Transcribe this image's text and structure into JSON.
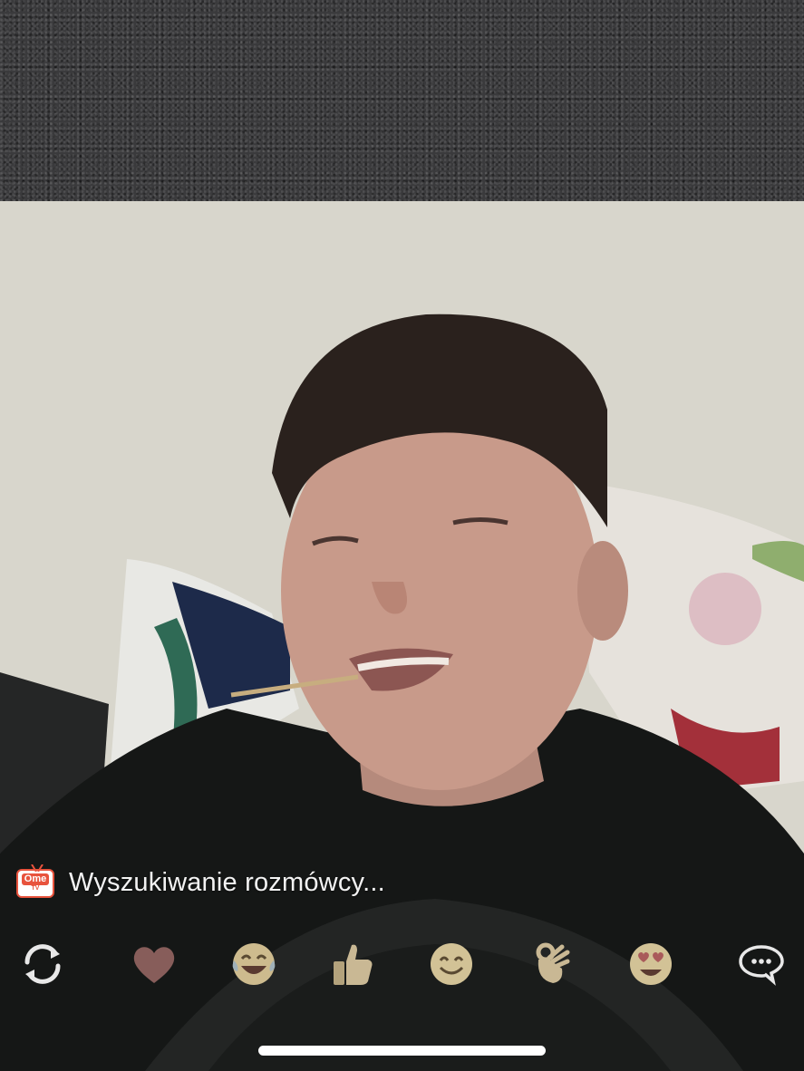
{
  "app": {
    "logo": {
      "name": "OmeTV",
      "top_text": "Ome",
      "bottom_text": "TV"
    }
  },
  "status": {
    "text": "Wyszukiwanie rozmówcy..."
  },
  "toolbar": {
    "items": [
      {
        "icon": "refresh-icon"
      },
      {
        "icon": "heart-icon"
      },
      {
        "icon": "laughing-tears-emoji-icon"
      },
      {
        "icon": "thumbs-up-icon"
      },
      {
        "icon": "smile-emoji-icon"
      },
      {
        "icon": "ok-hand-icon"
      },
      {
        "icon": "heart-eyes-emoji-icon"
      },
      {
        "icon": "chat-bubble-icon"
      }
    ]
  },
  "colors": {
    "brand": "#e8533d",
    "overlay_text": "#f3f3f3",
    "reaction_tint": "#d9c9a0"
  }
}
